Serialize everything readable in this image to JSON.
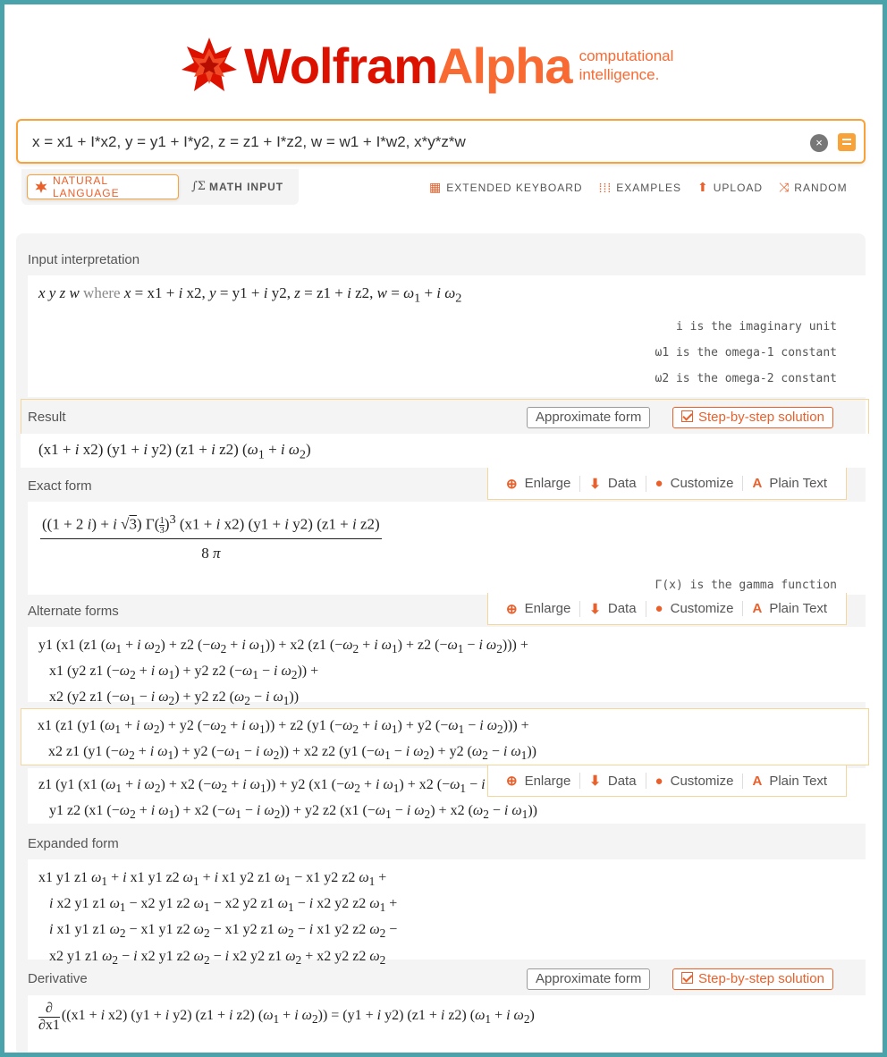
{
  "logo": {
    "wolfram": "Wolfram",
    "alpha": "Alpha",
    "sub_line1": "computational",
    "sub_line2": "intelligence."
  },
  "search": {
    "value": "x = x1 + I*x2, y = y1 + I*y2, z = z1 + I*z2, w = w1 + I*w2, x*y*z*w",
    "clear_icon": "×"
  },
  "modes": {
    "natural": "NATURAL LANGUAGE",
    "math": "MATH INPUT"
  },
  "tools": {
    "keyboard": "EXTENDED KEYBOARD",
    "examples": "EXAMPLES",
    "upload": "UPLOAD",
    "random": "RANDOM"
  },
  "pods": {
    "input": {
      "title": "Input interpretation",
      "notes": [
        "i is the imaginary unit",
        "ω1 is the omega-1 constant",
        "ω2 is the omega-2 constant"
      ]
    },
    "result": {
      "title": "Result",
      "approx": "Approximate form",
      "step": "Step-by-step solution"
    },
    "exact": {
      "title": "Exact form",
      "note": "Γ(x) is the gamma function"
    },
    "alternate": {
      "title": "Alternate forms"
    },
    "expanded": {
      "title": "Expanded form"
    },
    "derivative": {
      "title": "Derivative",
      "approx": "Approximate form",
      "step": "Step-by-step solution"
    }
  },
  "actions": {
    "enlarge": "Enlarge",
    "data": "Data",
    "customize": "Customize",
    "plain": "Plain Text"
  },
  "colors": {
    "brand_red": "#dd1100",
    "brand_orange": "#f96932",
    "accent": "#e8612c",
    "frame": "#4aa3ab"
  }
}
